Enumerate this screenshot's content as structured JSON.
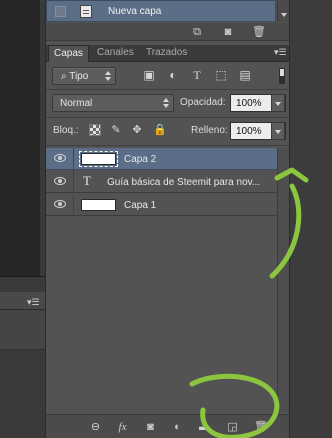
{
  "history": {
    "snapshot_label": "Nueva capa"
  },
  "tabs": [
    {
      "label": "Capas",
      "active": true
    },
    {
      "label": "Canales",
      "active": false
    },
    {
      "label": "Trazados",
      "active": false
    }
  ],
  "filter": {
    "kind_label": "Tipo",
    "icons": [
      "image-filter-icon",
      "adjustment-filter-icon",
      "type-filter-icon",
      "shape-filter-icon",
      "smart-object-filter-icon"
    ]
  },
  "blend": {
    "mode": "Normal",
    "opacity_label": "Opacidad:",
    "opacity_value": "100%"
  },
  "lock": {
    "label": "Bloq.:",
    "fill_label": "Relleno:",
    "fill_value": "100%"
  },
  "layers": [
    {
      "name": "Capa 2",
      "type": "pixel",
      "visible": true,
      "selected": true
    },
    {
      "name": "Guía básica de Steemit para nov...",
      "type": "text",
      "visible": true,
      "selected": false
    },
    {
      "name": "Capa 1",
      "type": "pixel",
      "visible": true,
      "selected": false
    }
  ],
  "text_layer_glyph": "T",
  "bottom_toolbar": {
    "fx_label": "fx",
    "icons": [
      "link-layers-icon",
      "layer-style-icon",
      "layer-mask-icon",
      "adjustment-layer-icon",
      "new-group-icon",
      "new-layer-icon",
      "delete-layer-icon"
    ]
  },
  "annotation_color": "#8cc63f",
  "selection_color": "#5c6e87"
}
